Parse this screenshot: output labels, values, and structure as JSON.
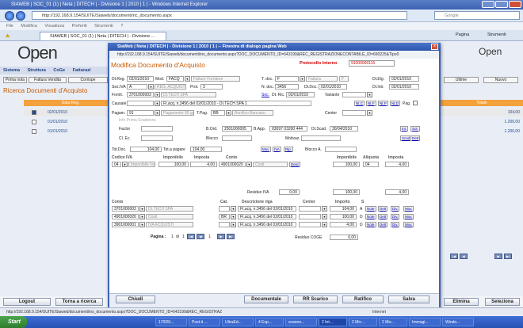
{
  "ie": {
    "title": "SIAWEB | SOC_01 (1) | Neta | DITECH | - Divisione 1 | 2010 | 1 | - Windows Internet Explorer",
    "url": "http://192.168.9.154/SUITE/Siaweb/documenti/ric_documento.aspx",
    "search_placeholder": "Google",
    "menu": [
      "File",
      "Modifica",
      "Visualizza",
      "Preferiti",
      "Strumenti",
      "?"
    ],
    "tab_label": "SIAWEB | SOC_01 (1) | Neta | DITECH | - Divisione ...",
    "toolbar_pagina": "Pagina",
    "toolbar_strumenti": "Strumenti",
    "status_url": "http://192.168.9.154/SUITE/Siaweb/documenti/ins_documento.aspx?DOC_DOCUMENTO_ID=643199&REC_REGISTRAZ",
    "status_zone": "Internet"
  },
  "bg": {
    "logo": "Open",
    "nav": [
      "Sistema",
      "Struttura",
      "CoGe",
      "Fatturazi"
    ],
    "btn_prima_nota": "Prima nota",
    "btn_fattura_vendita": "Fattura Vendita",
    "btn_corrispettivi": "Corrispe",
    "heading": "Ricerca Documenti d'Acquisto",
    "col_data_reg": "Data Reg.",
    "rows": [
      "02/01/2010",
      "01/01/2010",
      "01/01/2010"
    ],
    "right_tab_ultime": "Ultime",
    "right_tab_nuovo": "Nuovo",
    "col_totale": "Totale",
    "totals": [
      "104,00",
      "1.200,00",
      "1.200,00"
    ],
    "btn_logout": "Logout",
    "btn_torna_ricerca": "Torna a ricerca",
    "btn_elimina": "Elimina",
    "btn_seleziona": "Seleziona"
  },
  "taskbar": {
    "start": "Start",
    "items": [
      "17005/...",
      "Post-it ...",
      "UltraEd...",
      "4 Esp...",
      "scanne...",
      "2 Int...",
      "2 Mic...",
      "2 Mic...",
      "Immagi...",
      "Windo..."
    ]
  },
  "dlg": {
    "title": "SiaWeb | Neta | DITECH | - Divisione 1 | 2010 | 1 | -- Finestra di dialogo pagina Web",
    "url": "http://192.168.9.154/SUITE/Siaweb/documenti/ins_documento.aspx?DOC_DOCUMENTO_ID=643199&REC_REGISTRAZIONECONTABILE_ID=690225&Tipo0",
    "heading": "Modifica Documento d'Acquisto",
    "proto_label": "Protocollo Interno",
    "proto_value": "91000000115",
    "dtreg_label": "Dt.Reg.",
    "dtreg": "02/01/2010",
    "mod_label": "Mod.",
    "mod": "FACQ",
    "mod_desc": "Fatture Fornitore",
    "tdoc_label": "T. doc.",
    "tdoc": "F",
    "tdoc_desc": "Fattura",
    "tdoc_code": "F",
    "dteleg_label": "Dt.Elg.",
    "dteleg": "02/01/2010",
    "seziva_label": "Sez.IVA",
    "seziva": "A",
    "seziva_desc": "REG. ACQUISTI",
    "prot_label": "Prot.",
    "prot": "3",
    "ndoc_label": "N. doc.",
    "ndoc": "3456",
    "dtdoc_label": "Dt.Doc.",
    "dtdoc": "02/01/2010",
    "dtintr_label": "Dt.Intr.",
    "dtintr": "02/01/2010",
    "fornit_label": "Fornit.",
    "fornit": "3701000003",
    "fornit_desc": "DI.TECH SPA",
    "soc_label": "Soc.",
    "dtric_label": "Dt. Ric.",
    "dtric": "02/01/2010",
    "variante_label": "Variante",
    "causale_label": "Causale",
    "causale_desc": "Ft.acq. n.3456 del 02/01/2010 - DI.TECH SPA 1",
    "nc_link": "Nt.C",
    "nf_link": "Nt.F",
    "np_link": "Nt.P",
    "nd_link": "Nt.D",
    "pag_label": "Pag.",
    "pagam_label": "Pagam.",
    "pagam": "91",
    "pagam_desc": "Pagamento 90 gg.fm",
    "tpag_label": "T.Pag.",
    "tpag": "BB",
    "tpag_desc": "Bonifico Bancario",
    "center_label": "Center",
    "prima_scad_label": "Info Prima Scadenza",
    "factor_label": "Factor",
    "bord_label": "B.Ord.",
    "bord": "2501000005",
    "bapp_label": "B.App.",
    "bapp": "03097 03200 444",
    "dtscad_label": "Dt.Scad.",
    "dtscad": "30/04/2010",
    "cc_label": "Cl. Ec.",
    "blocco_label": "Blocco",
    "motivaz_label": "Motivaz.",
    "int_link": "Int.",
    "sol_link": "Sol.",
    "scad_link": "Scad",
    "dett_link": "Dett",
    "totdoc_label": "Tot.Doc.",
    "totdoc": "104,00",
    "totpag_label": "Tot.a pagare",
    "totpag": "104,00",
    "mov_link": "Mov",
    "iva_link": "IVA",
    "rip_link": "Rip.",
    "bloccoa_label": "Blocco A.",
    "iva_head": {
      "codice": "Codice IVA",
      "imponibile": "Imponibile",
      "imposta": "Imposta",
      "conto": "Conto",
      "imponibile2": "Imponibile",
      "aliquota": "Aliquota",
      "imposta2": "Imposta"
    },
    "iva_row": {
      "codice": "04",
      "desc": "Imponibile Iva 4",
      "imponibile": "100,00",
      "imposta": "4,00",
      "conto": "4901000020",
      "conto_desc": "Costi",
      "desc_link": "Desc",
      "imponibile2": "100,00",
      "aliquota": "04",
      "imposta2": "4,00"
    },
    "residuo_label": "Residuo IVA",
    "residuo": "0,00",
    "residuo_a": "100,00",
    "residuo_b": "4,00",
    "rows_head": {
      "conto": "Conto",
      "cat": "Cat.",
      "descr": "Descrizione riga",
      "center": "Center",
      "importo": "Importo",
      "s": "S"
    },
    "rows": [
      {
        "conto": "3701000003",
        "desc": "DI.TECH SPA",
        "cat": "",
        "descr": "Ft.acq. n.3456 del 02/01/2010",
        "importo": "104,00",
        "s": "A"
      },
      {
        "conto": "4901000020",
        "desc": "Costi",
        "cat": "BR",
        "descr": "Ft.acq. n.3456 del 02/01/2010",
        "importo": "100,00",
        "s": "D"
      },
      {
        "conto": "3901000001",
        "desc": "IVA ACQUISTI",
        "cat": "",
        "descr": "Ft.acq. n.3456 del 02/01/2010",
        "importo": "4,00",
        "s": "D"
      }
    ],
    "row_links": [
      "Note",
      "Dett",
      "Div.",
      "Mov."
    ],
    "pagina_label": "Pagina :",
    "pagina_cur": "1",
    "pagina_di": "di",
    "pagina_tot": "1",
    "residuo_coge_label": "Residuo COGE",
    "residuo_coge": "0,00",
    "btn_chiudi": "Chiudi",
    "btn_documentale": "Documentale",
    "btn_rr_scarico": "RR Scarico",
    "btn_ratifico": "Ratifico",
    "btn_salva": "Salva"
  }
}
